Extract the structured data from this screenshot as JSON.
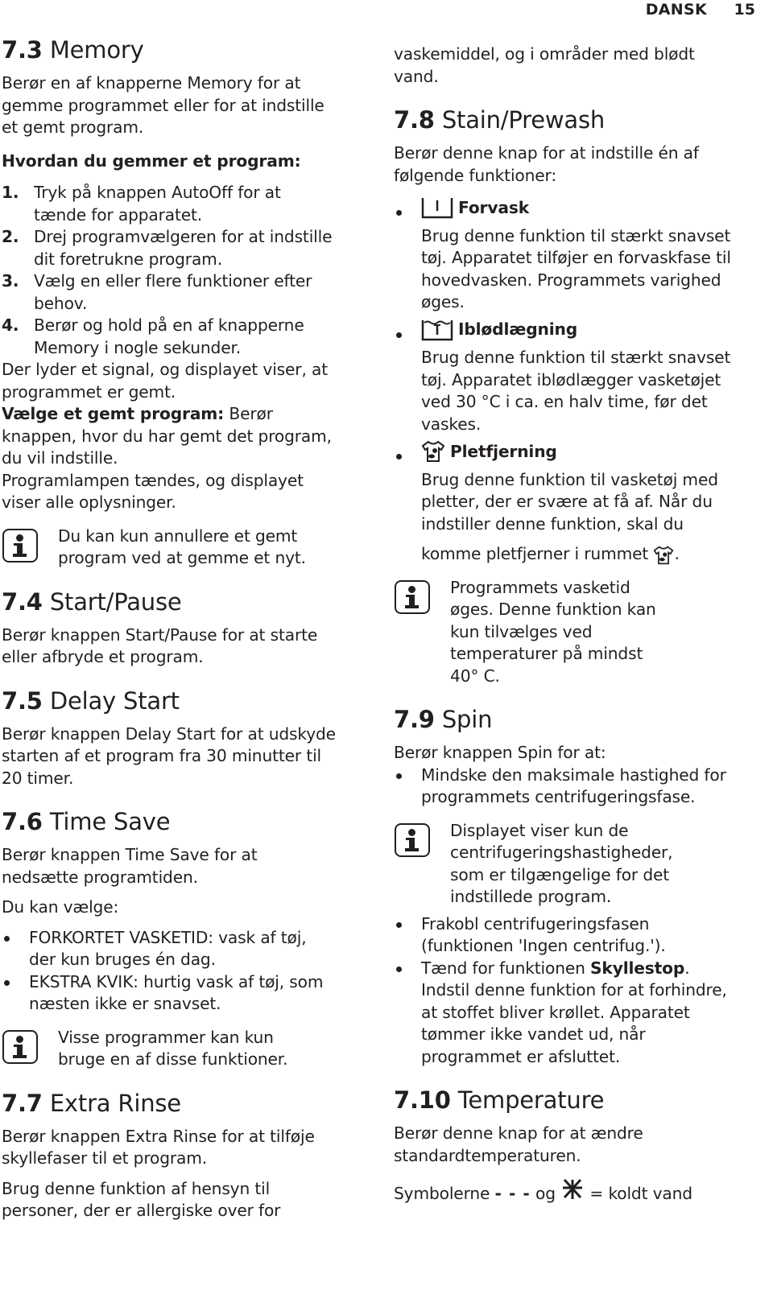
{
  "header": {
    "language": "DANSK",
    "page_number": "15"
  },
  "left": {
    "memory": {
      "heading_num": "7.3",
      "heading_text": "Memory",
      "intro": [
        "Berør en af knapperne Memory for at",
        "gemme programmet eller for at indstille",
        "et gemt program."
      ],
      "how_to_title": "Hvordan du gemmer et program:",
      "steps": [
        {
          "num": "1.",
          "lines": [
            "Tryk på knappen AutoOff for at",
            "tænde for apparatet."
          ]
        },
        {
          "num": "2.",
          "lines": [
            "Drej programvælgeren for at indstille",
            "dit foretrukne program."
          ]
        },
        {
          "num": "3.",
          "lines": [
            "Vælg en eller flere funktioner efter",
            "behov."
          ]
        },
        {
          "num": "4.",
          "lines": [
            "Berør og hold på en af knapperne",
            "Memory i nogle sekunder."
          ]
        }
      ],
      "after_steps": [
        "Der lyder et signal, og displayet viser, at",
        "programmet er gemt."
      ],
      "select_bold": "Vælge et gemt program:",
      "select_rest_first": " Berør",
      "select_lines": [
        "knappen, hvor du har gemt det program,",
        "du vil indstille."
      ],
      "lamp_lines": [
        "Programlampen tændes, og displayet",
        "viser alle oplysninger."
      ],
      "info": [
        "Du kan kun annullere et gemt",
        "program ved at gemme et nyt."
      ]
    },
    "start_pause": {
      "heading_num": "7.4",
      "heading_text": "Start/Pause",
      "body": [
        "Berør knappen Start/Pause for at starte",
        "eller afbryde et program."
      ]
    },
    "delay_start": {
      "heading_num": "7.5",
      "heading_text": "Delay Start",
      "body": [
        "Berør knappen Delay Start for at udskyde",
        "starten af et program fra 30 minutter til",
        "20 timer."
      ]
    },
    "time_save": {
      "heading_num": "7.6",
      "heading_text": "Time Save",
      "body": [
        "Berør knappen Time Save for at",
        "nedsætte programtiden."
      ],
      "choose": "Du kan vælge:",
      "options": [
        {
          "lines": [
            "FORKORTET VASKETID: vask af tøj,",
            "der kun bruges én dag."
          ]
        },
        {
          "lines": [
            "EKSTRA KVIK: hurtig vask af tøj, som",
            "næsten ikke er snavset."
          ]
        }
      ],
      "info": [
        "Visse programmer kan kun",
        "bruge en af disse funktioner."
      ]
    },
    "extra_rinse": {
      "heading_num": "7.7",
      "heading_text": "Extra Rinse",
      "body": [
        "Berør knappen Extra Rinse for at tilføje",
        "skyllefaser til et program."
      ],
      "body2": [
        "Brug denne funktion af hensyn til",
        "personer, der er allergiske over for"
      ]
    }
  },
  "right": {
    "continued": [
      "vaskemiddel, og i områder med blødt",
      "vand."
    ],
    "stain_prewash": {
      "heading_num": "7.8",
      "heading_text": "Stain/Prewash",
      "intro": [
        "Berør denne knap for at indstille én af",
        "følgende funktioner:"
      ],
      "functions": [
        {
          "icon": "prewash-icon",
          "title": "Forvask",
          "lines": [
            "Brug denne funktion til stærkt snavset",
            "tøj. Apparatet tilføjer en forvaskfase til",
            "hovedvasken. Programmets varighed",
            "øges."
          ]
        },
        {
          "icon": "soak-icon",
          "title": "Iblødlægning",
          "lines": [
            "Brug denne funktion til stærkt snavset",
            "tøj. Apparatet iblødlægger vasketøjet",
            "ved 30 °C i ca. en halv time, før det",
            "vaskes."
          ]
        },
        {
          "icon": "stain-icon",
          "title": "Pletfjerning",
          "lines": [
            "Brug denne funktion til vasketøj med",
            "pletter, der er svære at få af. Når du",
            "indstiller denne funktion, skal du"
          ],
          "last_line": "komme pletfjerner i rummet",
          "last_suffix": "."
        }
      ],
      "info": [
        "Programmets vasketid",
        "øges. Denne funktion kan",
        "kun tilvælges ved",
        "temperaturer på mindst",
        "40° C."
      ]
    },
    "spin": {
      "heading_num": "7.9",
      "heading_text": "Spin",
      "intro": "Berør knappen Spin for at:",
      "bullet1": [
        "Mindske den maksimale hastighed for",
        "programmets centrifugeringsfase."
      ],
      "info": [
        "Displayet viser kun de",
        "centrifugeringshastigheder,",
        "som er tilgængelige for det",
        "indstillede program."
      ],
      "bullet2": [
        "Frakobl centrifugeringsfasen",
        "(funktionen 'Ingen centrifug.')."
      ],
      "bullet3_pre": "Tænd for funktionen ",
      "bullet3_bold": "Skyllestop",
      "bullet3_post": ".",
      "bullet3_lines": [
        "Indstil denne funktion for at forhindre,",
        "at stoffet bliver krøllet. Apparatet",
        "tømmer ikke vandet ud, når",
        "programmet er afsluttet."
      ]
    },
    "temperature": {
      "heading_num": "7.10",
      "heading_text": "Temperature",
      "body": [
        "Berør denne knap for at ændre",
        "standardtemperaturen."
      ],
      "symbols_pre": "Symbolerne ",
      "symbols_dashes": "- - -",
      "symbols_mid": " og ",
      "symbols_post": " = koldt vand"
    }
  }
}
